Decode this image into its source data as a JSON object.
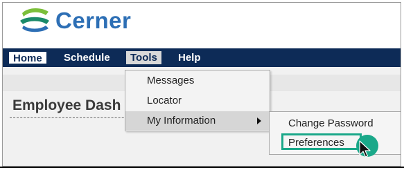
{
  "brand": {
    "name": "Cerner",
    "colors": {
      "primary": "#2d6fb5",
      "logo_green": "#7bbf3a"
    }
  },
  "menubar": {
    "items": [
      {
        "label": "Home"
      },
      {
        "label": "Schedule"
      },
      {
        "label": "Tools"
      },
      {
        "label": "Help"
      }
    ],
    "color": "#0d2b57"
  },
  "page": {
    "title": "Employee Dash"
  },
  "tools_menu": {
    "items": [
      {
        "label": "Messages"
      },
      {
        "label": "Locator"
      },
      {
        "label": "My Information"
      }
    ]
  },
  "my_information_menu": {
    "items": [
      {
        "label": "Change Password"
      },
      {
        "label": "Preferences"
      }
    ]
  },
  "highlight_color": "#1aa889"
}
